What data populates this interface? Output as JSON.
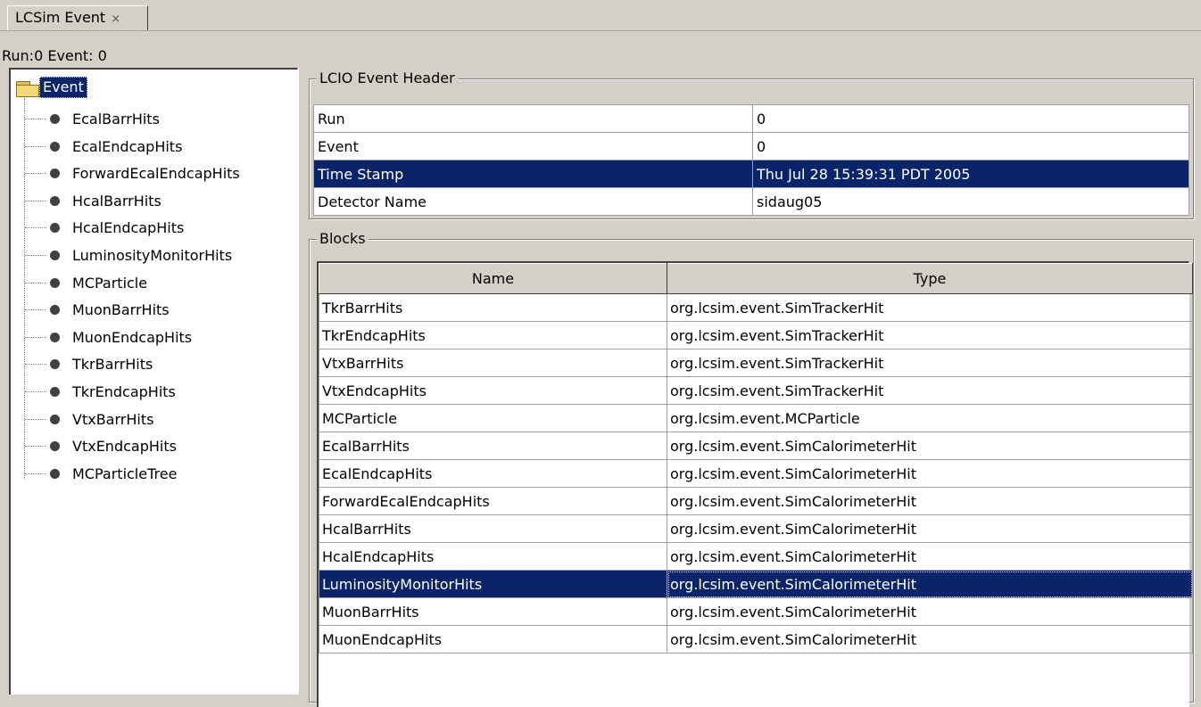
{
  "tab": {
    "title": "LCSim Event",
    "close": "×"
  },
  "status": {
    "text": "Run:0  Event: 0"
  },
  "tree": {
    "root": "Event",
    "items": [
      "EcalBarrHits",
      "EcalEndcapHits",
      "ForwardEcalEndcapHits",
      "HcalBarrHits",
      "HcalEndcapHits",
      "LuminosityMonitorHits",
      "MCParticle",
      "MuonBarrHits",
      "MuonEndcapHits",
      "TkrBarrHits",
      "TkrEndcapHits",
      "VtxBarrHits",
      "VtxEndcapHits",
      "MCParticleTree"
    ]
  },
  "header": {
    "title": "LCIO Event Header",
    "rows": [
      {
        "key": "Run",
        "value": "0"
      },
      {
        "key": "Event",
        "value": "0"
      },
      {
        "key": "Time Stamp",
        "value": "Thu Jul 28 15:39:31 PDT 2005"
      },
      {
        "key": "Detector Name",
        "value": "sidaug05"
      }
    ],
    "selected_row": 2
  },
  "blocks": {
    "title": "Blocks",
    "columns": [
      "Name",
      "Type"
    ],
    "rows": [
      {
        "name": "TkrBarrHits",
        "type": "org.lcsim.event.SimTrackerHit"
      },
      {
        "name": "TkrEndcapHits",
        "type": "org.lcsim.event.SimTrackerHit"
      },
      {
        "name": "VtxBarrHits",
        "type": "org.lcsim.event.SimTrackerHit"
      },
      {
        "name": "VtxEndcapHits",
        "type": "org.lcsim.event.SimTrackerHit"
      },
      {
        "name": "MCParticle",
        "type": "org.lcsim.event.MCParticle"
      },
      {
        "name": "EcalBarrHits",
        "type": "org.lcsim.event.SimCalorimeterHit"
      },
      {
        "name": "EcalEndcapHits",
        "type": "org.lcsim.event.SimCalorimeterHit"
      },
      {
        "name": "ForwardEcalEndcapHits",
        "type": "org.lcsim.event.SimCalorimeterHit"
      },
      {
        "name": "HcalBarrHits",
        "type": "org.lcsim.event.SimCalorimeterHit"
      },
      {
        "name": "HcalEndcapHits",
        "type": "org.lcsim.event.SimCalorimeterHit"
      },
      {
        "name": "LuminosityMonitorHits",
        "type": "org.lcsim.event.SimCalorimeterHit"
      },
      {
        "name": "MuonBarrHits",
        "type": "org.lcsim.event.SimCalorimeterHit"
      },
      {
        "name": "MuonEndcapHits",
        "type": "org.lcsim.event.SimCalorimeterHit"
      }
    ],
    "selected_row": 10
  },
  "colors": {
    "selection": "#0a246a",
    "panel": "#d4d0c8"
  }
}
